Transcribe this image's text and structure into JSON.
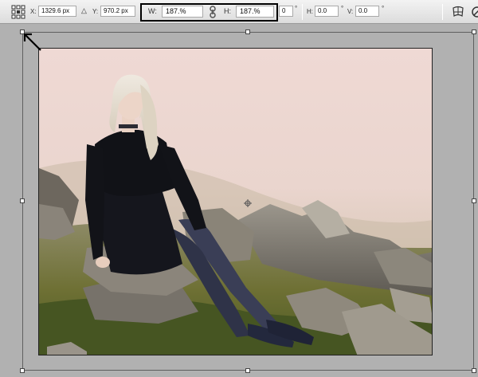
{
  "options_bar": {
    "x_label": "X:",
    "x_value": "1329.6 px",
    "y_label": "Y:",
    "y_value": "970.2 px",
    "w_label": "W:",
    "w_value": "187.%",
    "h_label": "H:",
    "h_value": "187.%",
    "rotate_value": "0",
    "rotate_unit": "°",
    "skew_h_label": "H:",
    "skew_h_value": "0.0",
    "skew_h_unit": "°",
    "skew_v_label": "V:",
    "skew_v_value": "0.0",
    "skew_v_unit": "°",
    "icons": {
      "reference_point": "reference-point-locator-icon",
      "delta": "relative-position-triangle-icon",
      "link": "maintain-aspect-ratio-link-icon",
      "warp": "warp-mode-icon",
      "cancel": "cancel-transform-icon"
    }
  },
  "document": {
    "content": "photo-canvas",
    "highlight_color": "#000000"
  },
  "colors": {
    "workspace": "#b1b1b1",
    "toolbar": "#e6e6e6",
    "annotation": "#000000"
  }
}
